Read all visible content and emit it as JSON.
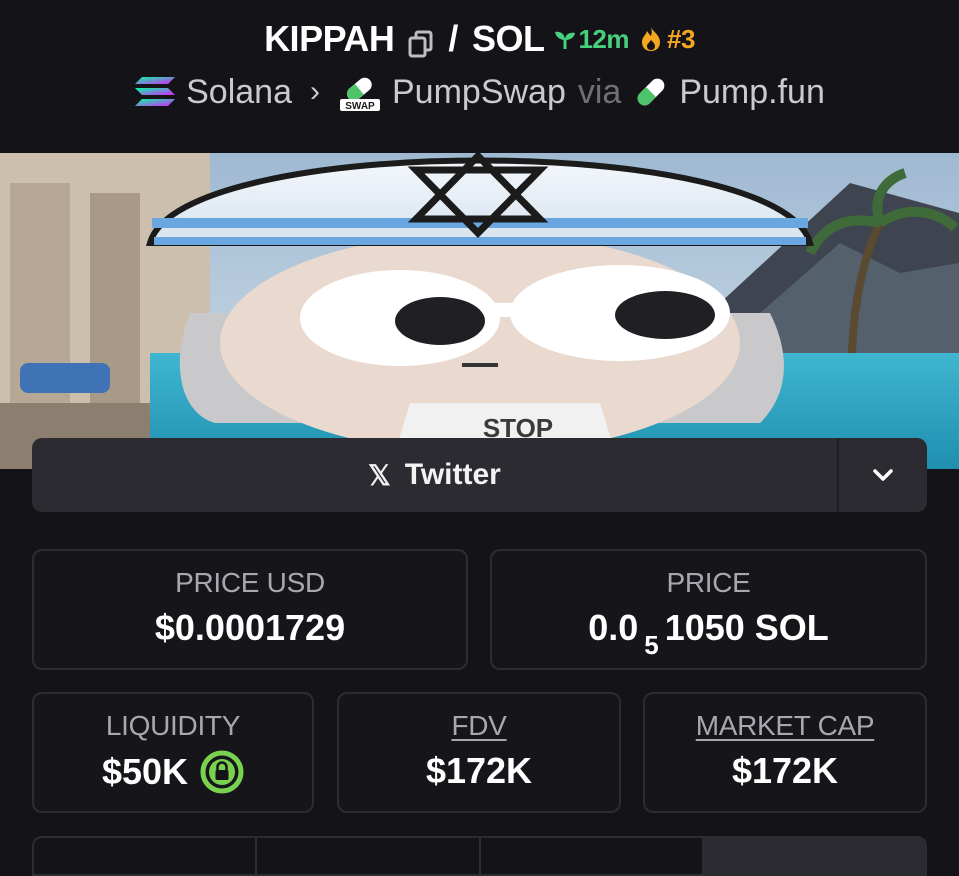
{
  "header": {
    "token_symbol": "KIPPAH",
    "separator": "/",
    "quote_symbol": "SOL",
    "age": "12m",
    "rank": "#3",
    "breadcrumb": {
      "chain": "Solana",
      "dex": "PumpSwap",
      "dex_badge": "SWAP",
      "via": "via",
      "launchpad": "Pump.fun"
    }
  },
  "banner": {
    "shirt_text": "STOP"
  },
  "social": {
    "twitter_label": "Twitter",
    "x_glyph": "𝕏"
  },
  "stats": {
    "price_usd": {
      "label": "PRICE USD",
      "value": "$0.0001729"
    },
    "price": {
      "label": "PRICE",
      "prefix": "0.0",
      "zeros": "5",
      "suffix": "1050 SOL"
    },
    "liquidity": {
      "label": "LIQUIDITY",
      "value": "$50K",
      "locked": true
    },
    "fdv": {
      "label": "FDV",
      "value": "$172K"
    },
    "market_cap": {
      "label": "MARKET CAP",
      "value": "$172K"
    }
  },
  "colors": {
    "background": "#141418",
    "card_border": "#2c2c33",
    "age_green": "#47d17c",
    "rank_orange": "#f5a623",
    "lock_green": "#7ad04f"
  },
  "icons": {
    "copy": "copy-icon",
    "seedling": "seedling-icon",
    "flame": "flame-icon",
    "solana": "solana-logo-icon",
    "pumpswap": "pumpswap-pill-icon",
    "pumpfun": "pumpfun-pill-icon",
    "lock": "lock-icon",
    "chevron": "chevron-down-icon"
  }
}
